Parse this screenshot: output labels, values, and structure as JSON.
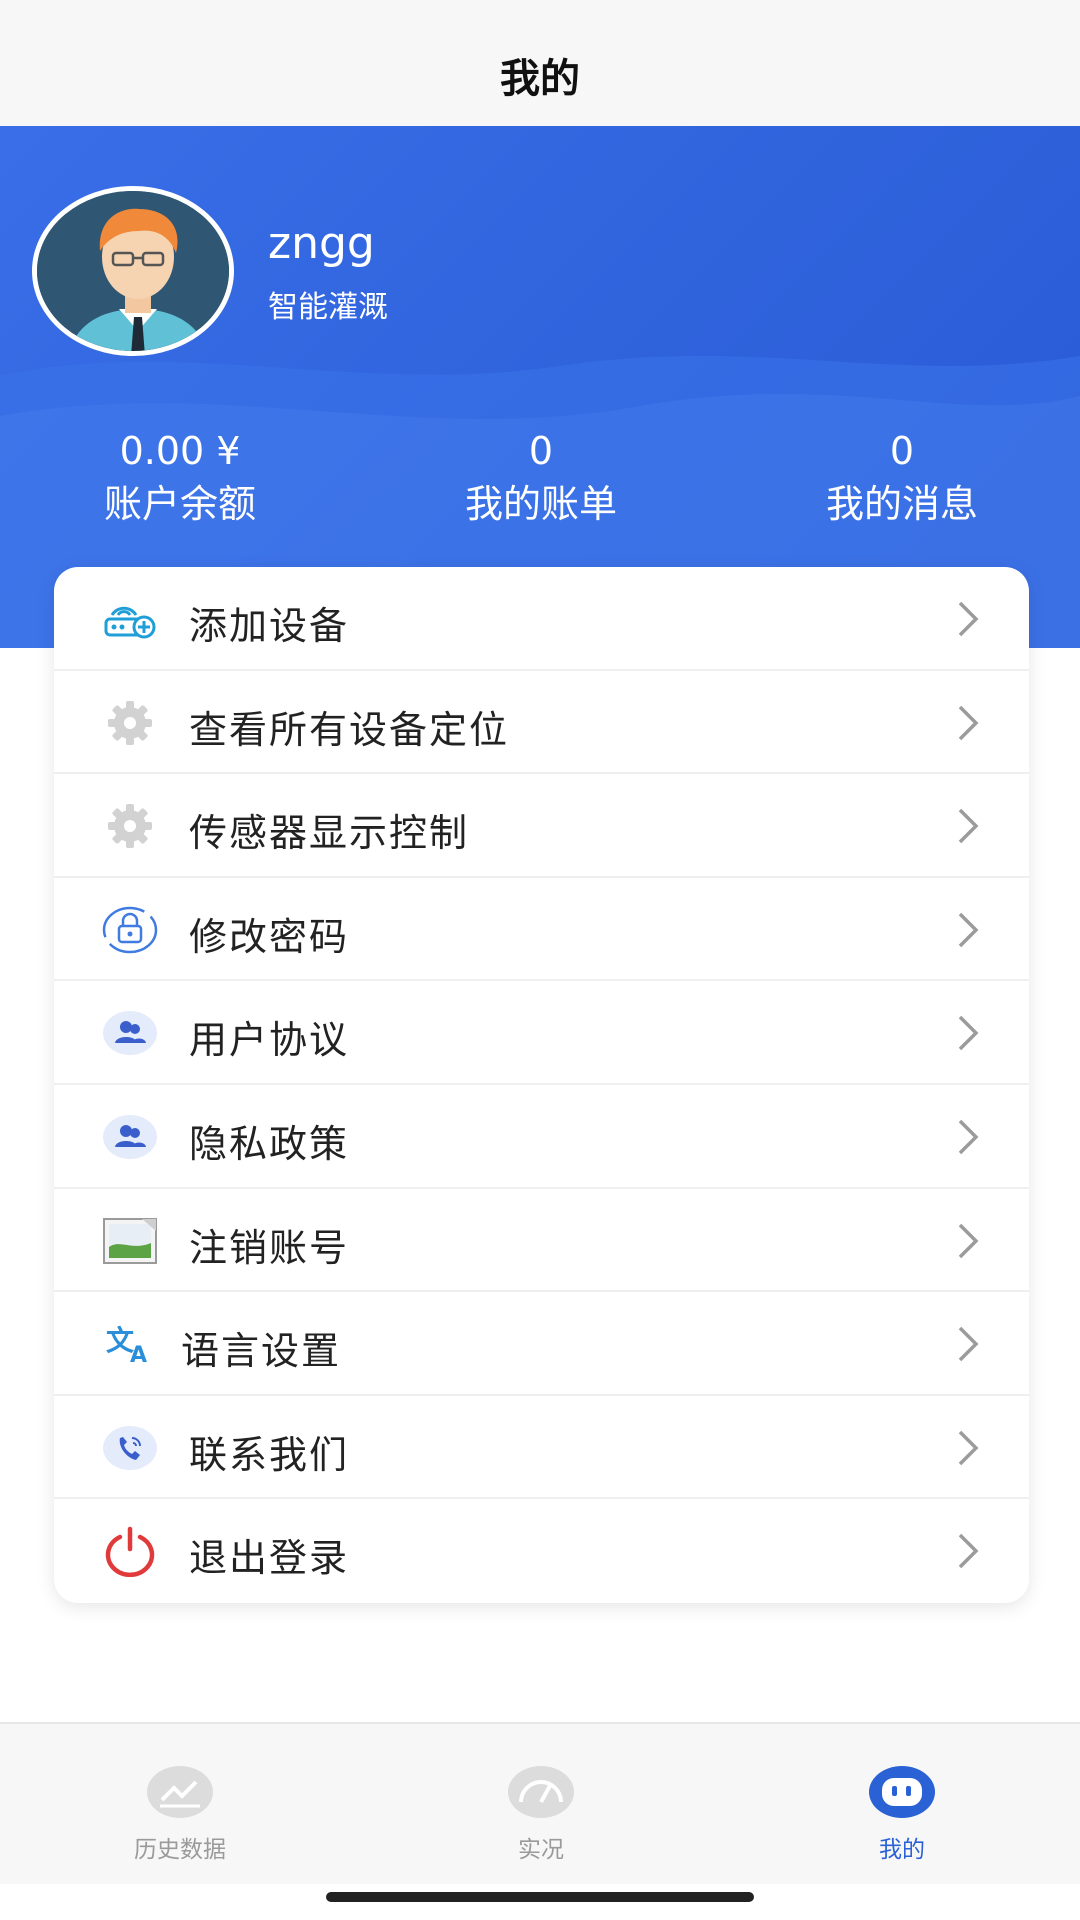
{
  "header": {
    "title": "我的"
  },
  "profile": {
    "username": "zngg",
    "subtitle": "智能灌溉"
  },
  "stats": [
    {
      "value": "0.00 ¥",
      "label": "账户余额"
    },
    {
      "value": "0",
      "label": "我的账单"
    },
    {
      "value": "0",
      "label": "我的消息"
    }
  ],
  "menu": [
    {
      "label": "添加设备",
      "icon": "router-add-icon"
    },
    {
      "label": "查看所有设备定位",
      "icon": "gear-icon"
    },
    {
      "label": "传感器显示控制",
      "icon": "gear-icon"
    },
    {
      "label": "修改密码",
      "icon": "lock-icon"
    },
    {
      "label": "用户协议",
      "icon": "users-icon"
    },
    {
      "label": "隐私政策",
      "icon": "users-icon"
    },
    {
      "label": "注销账号",
      "icon": "image-placeholder-icon"
    },
    {
      "label": "语言设置",
      "icon": "translate-icon"
    },
    {
      "label": "联系我们",
      "icon": "phone-icon"
    },
    {
      "label": "退出登录",
      "icon": "power-icon"
    }
  ],
  "tabs": [
    {
      "label": "历史数据",
      "icon": "chart-icon",
      "active": false
    },
    {
      "label": "实况",
      "icon": "gauge-icon",
      "active": false
    },
    {
      "label": "我的",
      "icon": "chat-icon",
      "active": true
    }
  ],
  "colors": {
    "primary": "#2a62d6",
    "header_blue": "#3a6ee8",
    "power_red": "#e03a3a"
  }
}
